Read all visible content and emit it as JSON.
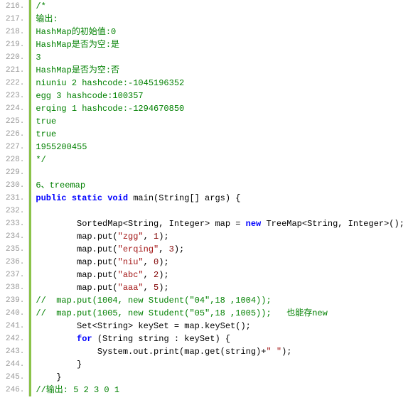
{
  "lines": [
    {
      "no": "216.",
      "tokens": [
        [
          "c",
          "/*"
        ]
      ]
    },
    {
      "no": "217.",
      "tokens": [
        [
          "c",
          "输出:"
        ]
      ]
    },
    {
      "no": "218.",
      "tokens": [
        [
          "c",
          "HashMap的初始值:0"
        ]
      ]
    },
    {
      "no": "219.",
      "tokens": [
        [
          "c",
          "HashMap是否为空:是"
        ]
      ]
    },
    {
      "no": "220.",
      "tokens": [
        [
          "c",
          "3"
        ]
      ]
    },
    {
      "no": "221.",
      "tokens": [
        [
          "c",
          "HashMap是否为空:否"
        ]
      ]
    },
    {
      "no": "222.",
      "tokens": [
        [
          "c",
          "niuniu 2 hashcode:-1045196352"
        ]
      ]
    },
    {
      "no": "223.",
      "tokens": [
        [
          "c",
          "egg 3 hashcode:100357"
        ]
      ]
    },
    {
      "no": "224.",
      "tokens": [
        [
          "c",
          "erqing 1 hashcode:-1294670850"
        ]
      ]
    },
    {
      "no": "225.",
      "tokens": [
        [
          "c",
          "true"
        ]
      ]
    },
    {
      "no": "226.",
      "tokens": [
        [
          "c",
          "true"
        ]
      ]
    },
    {
      "no": "227.",
      "tokens": [
        [
          "c",
          "1955200455"
        ]
      ]
    },
    {
      "no": "228.",
      "tokens": [
        [
          "c",
          "*/"
        ]
      ]
    },
    {
      "no": "229.",
      "tokens": [
        [
          "t",
          ""
        ]
      ]
    },
    {
      "no": "230.",
      "tokens": [
        [
          "c",
          "6、treemap"
        ]
      ]
    },
    {
      "no": "231.",
      "tokens": [
        [
          "k",
          "public static void"
        ],
        [
          "t",
          " main(String[] args) {"
        ]
      ]
    },
    {
      "no": "232.",
      "tokens": [
        [
          "t",
          ""
        ]
      ]
    },
    {
      "no": "233.",
      "tokens": [
        [
          "t",
          "        SortedMap<String, Integer> map = "
        ],
        [
          "k",
          "new"
        ],
        [
          "t",
          " TreeMap<String, Integer>();"
        ]
      ]
    },
    {
      "no": "234.",
      "tokens": [
        [
          "t",
          "        map.put("
        ],
        [
          "s",
          "\"zgg\""
        ],
        [
          "t",
          ", "
        ],
        [
          "n",
          "1"
        ],
        [
          "t",
          ");"
        ]
      ]
    },
    {
      "no": "235.",
      "tokens": [
        [
          "t",
          "        map.put("
        ],
        [
          "s",
          "\"erqing\""
        ],
        [
          "t",
          ", "
        ],
        [
          "n",
          "3"
        ],
        [
          "t",
          ");"
        ]
      ]
    },
    {
      "no": "236.",
      "tokens": [
        [
          "t",
          "        map.put("
        ],
        [
          "s",
          "\"niu\""
        ],
        [
          "t",
          ", "
        ],
        [
          "n",
          "0"
        ],
        [
          "t",
          ");"
        ]
      ]
    },
    {
      "no": "237.",
      "tokens": [
        [
          "t",
          "        map.put("
        ],
        [
          "s",
          "\"abc\""
        ],
        [
          "t",
          ", "
        ],
        [
          "n",
          "2"
        ],
        [
          "t",
          ");"
        ]
      ]
    },
    {
      "no": "238.",
      "tokens": [
        [
          "t",
          "        map.put("
        ],
        [
          "s",
          "\"aaa\""
        ],
        [
          "t",
          ", "
        ],
        [
          "n",
          "5"
        ],
        [
          "t",
          ");"
        ]
      ]
    },
    {
      "no": "239.",
      "tokens": [
        [
          "c",
          "//  map.put(1004, new Student(\"04\",18 ,1004));"
        ]
      ]
    },
    {
      "no": "240.",
      "tokens": [
        [
          "c",
          "//  map.put(1005, new Student(\"05\",18 ,1005));   也能存new"
        ]
      ]
    },
    {
      "no": "241.",
      "tokens": [
        [
          "t",
          "        Set<String> keySet = map.keySet();"
        ]
      ]
    },
    {
      "no": "242.",
      "tokens": [
        [
          "t",
          "        "
        ],
        [
          "k",
          "for"
        ],
        [
          "t",
          " (String string : keySet) {"
        ]
      ]
    },
    {
      "no": "243.",
      "tokens": [
        [
          "t",
          "            System.out.print(map.get(string)+"
        ],
        [
          "s",
          "\" \""
        ],
        [
          "t",
          ");"
        ]
      ]
    },
    {
      "no": "244.",
      "tokens": [
        [
          "t",
          "        }"
        ]
      ]
    },
    {
      "no": "245.",
      "tokens": [
        [
          "t",
          "    }"
        ]
      ]
    },
    {
      "no": "246.",
      "tokens": [
        [
          "c",
          "//输出: 5 2 3 0 1"
        ]
      ]
    }
  ]
}
